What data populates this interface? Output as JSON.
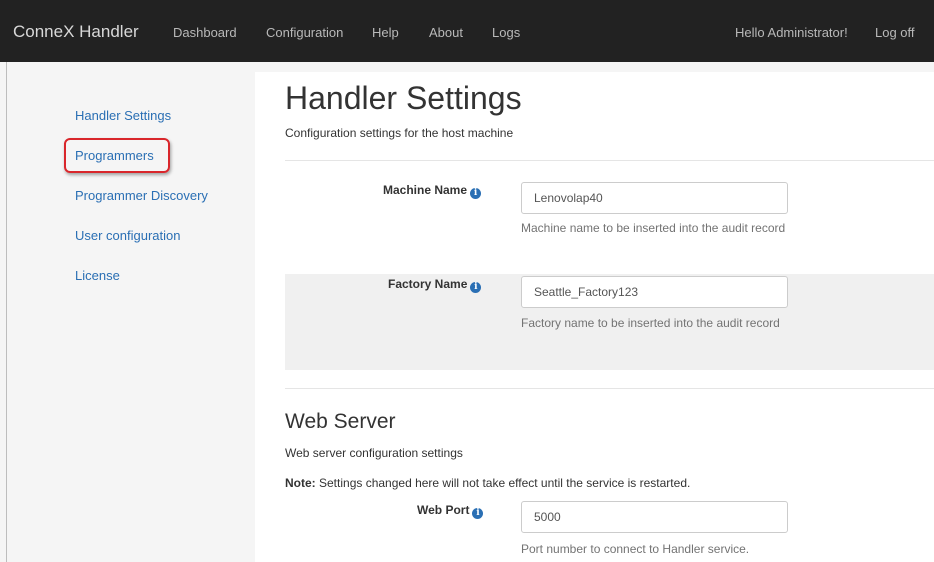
{
  "navbar": {
    "brand": "ConneX Handler",
    "items": [
      "Dashboard",
      "Configuration",
      "Help",
      "About",
      "Logs"
    ],
    "greeting": "Hello Administrator!",
    "logoff": "Log off"
  },
  "sidebar": {
    "items": [
      "Handler Settings",
      "Programmers",
      "Programmer Discovery",
      "User configuration",
      "License"
    ]
  },
  "main": {
    "title": "Handler Settings",
    "subtitle": "Configuration settings for the host machine",
    "machine_name": {
      "label": "Machine Name",
      "value": "Lenovolap40",
      "help": "Machine name to be inserted into the audit record"
    },
    "factory_name": {
      "label": "Factory Name",
      "value": "Seattle_Factory123",
      "help": "Factory name to be inserted into the audit record"
    },
    "web_server": {
      "title": "Web Server",
      "subtitle": "Web server configuration settings",
      "note_label": "Note:",
      "note_text": " Settings changed here will not take effect until the service is restarted.",
      "web_port": {
        "label": "Web Port",
        "value": "5000",
        "help": "Port number to connect to Handler service."
      }
    }
  },
  "icons": {
    "info": "info-circle-icon",
    "info_glyph": "i"
  },
  "colors": {
    "navbar_bg": "#222222",
    "link": "#2a6fb4",
    "highlight": "#d9262b"
  }
}
